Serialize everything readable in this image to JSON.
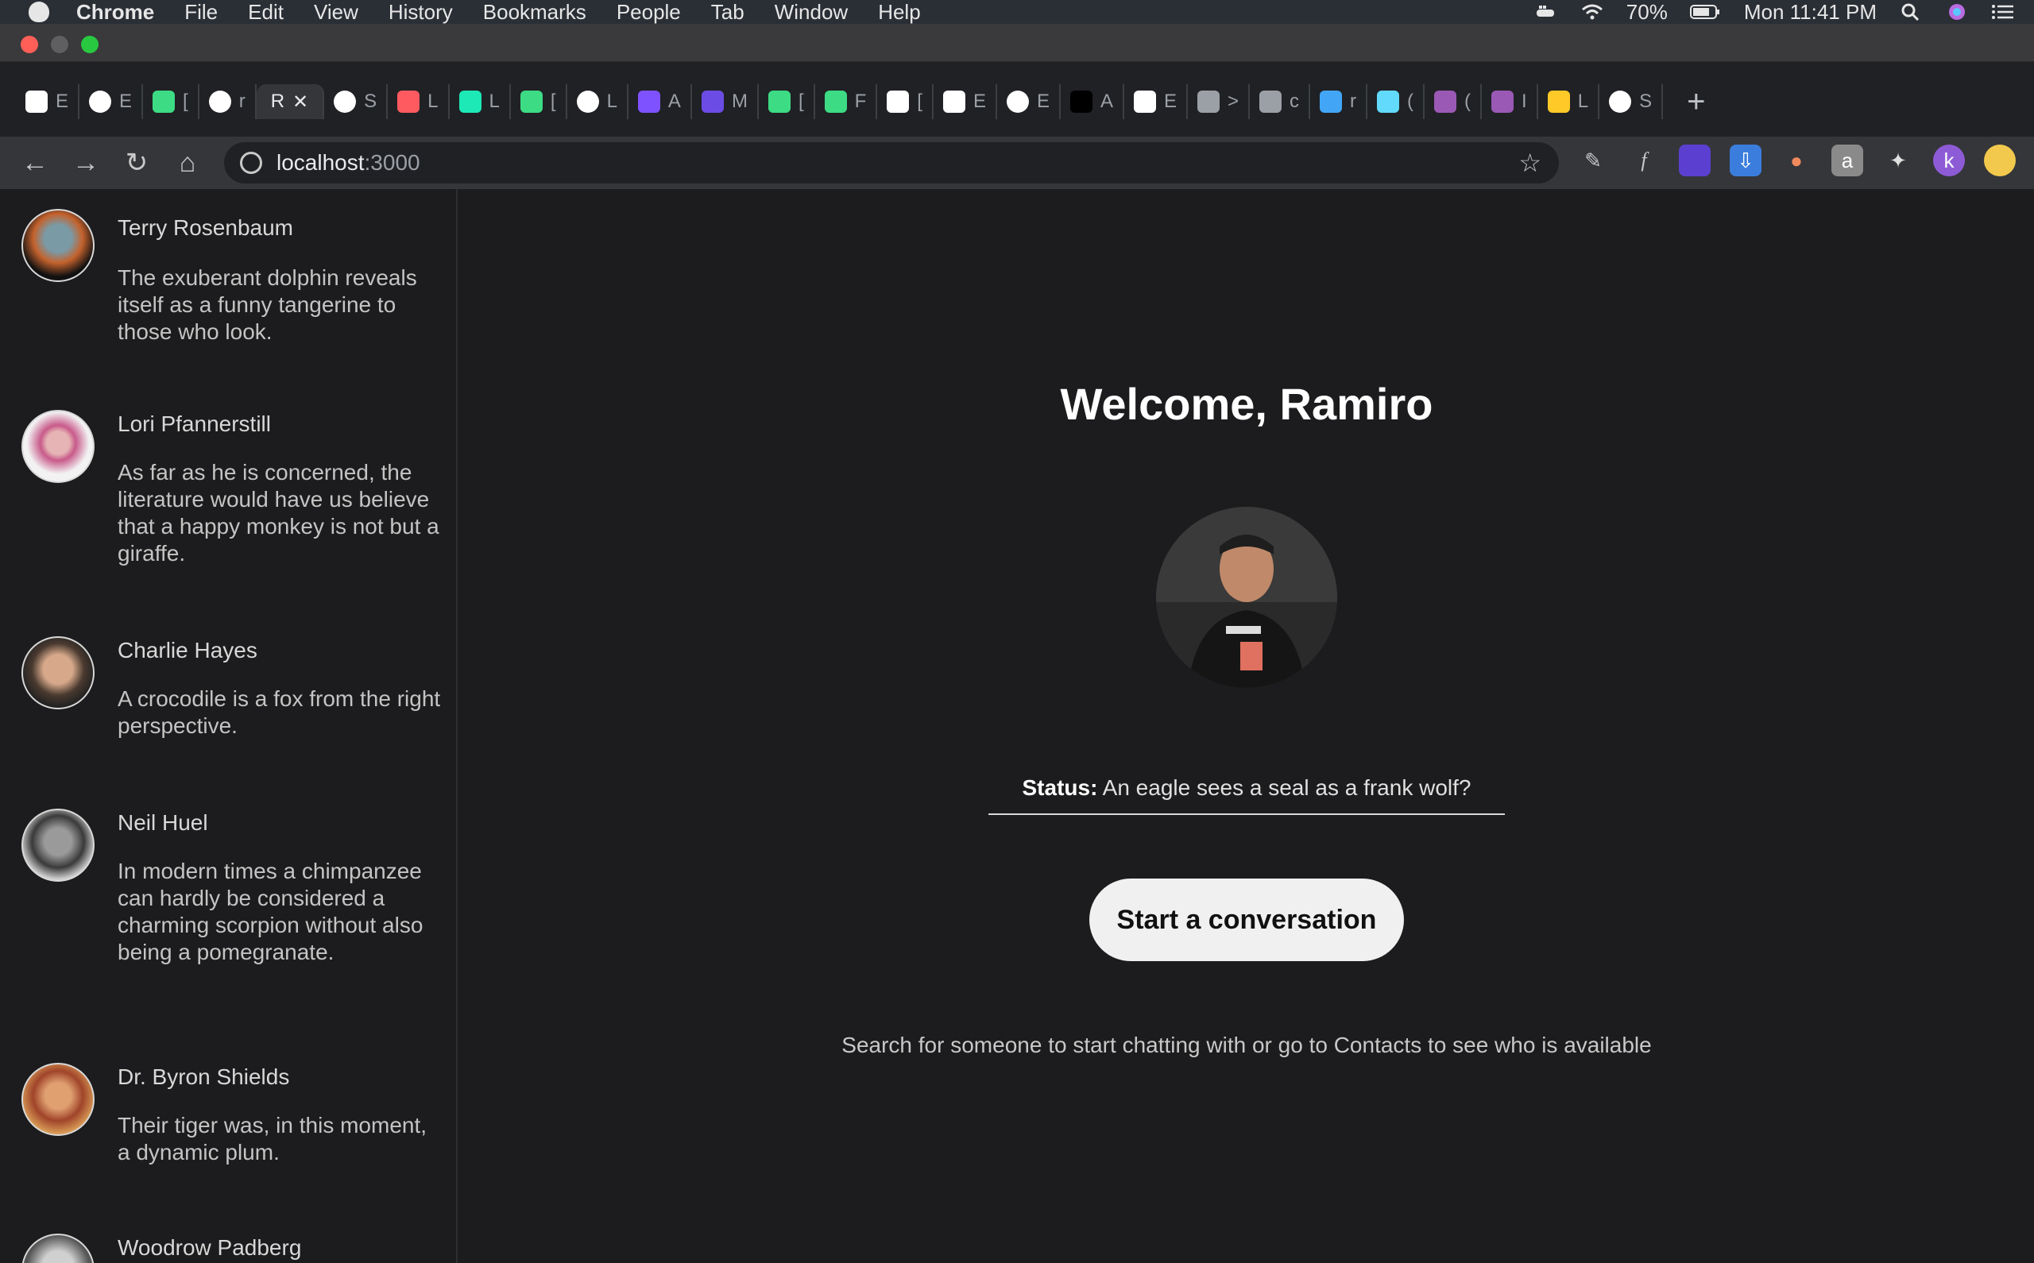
{
  "menubar": {
    "app": "Chrome",
    "items": [
      "File",
      "Edit",
      "View",
      "History",
      "Bookmarks",
      "People",
      "Tab",
      "Window",
      "Help"
    ],
    "battery": "70%",
    "clock": "Mon 11:41 PM"
  },
  "tabs": [
    {
      "label": "E",
      "icon": "gmail-icon",
      "color": "#ffffff"
    },
    {
      "label": "E",
      "icon": "compass-icon",
      "color": "#ffffff"
    },
    {
      "label": "[",
      "icon": "android-icon",
      "color": "#3ddc84"
    },
    {
      "label": "r",
      "icon": "github-icon",
      "color": "#ffffff"
    },
    {
      "label": "R",
      "icon": "",
      "color": "",
      "active": true
    },
    {
      "label": "S",
      "icon": "globe-icon",
      "color": "#ffffff"
    },
    {
      "label": "L",
      "icon": "airbnb-icon",
      "color": "#ff5a5f"
    },
    {
      "label": "L",
      "icon": "pen-icon",
      "color": "#1de9b6"
    },
    {
      "label": "[",
      "icon": "android-icon",
      "color": "#3ddc84"
    },
    {
      "label": "L",
      "icon": "compass-icon",
      "color": "#ffffff"
    },
    {
      "label": "A",
      "icon": "kotlin-icon",
      "color": "#7f52ff"
    },
    {
      "label": "M",
      "icon": "upwork-icon",
      "color": "#6b4de6"
    },
    {
      "label": "[",
      "icon": "android-icon",
      "color": "#3ddc84"
    },
    {
      "label": "F",
      "icon": "android-icon",
      "color": "#3ddc84"
    },
    {
      "label": "[",
      "icon": "medium-icon",
      "color": "#ffffff"
    },
    {
      "label": "E",
      "icon": "medium-icon",
      "color": "#ffffff"
    },
    {
      "label": "E",
      "icon": "meetup-icon",
      "color": "#ffffff"
    },
    {
      "label": "A",
      "icon": "dev-icon",
      "color": "#000000"
    },
    {
      "label": "E",
      "icon": "gmail-icon",
      "color": "#ffffff"
    },
    {
      "label": ">",
      "icon": "apple-icon",
      "color": "#9aa0a6"
    },
    {
      "label": "c",
      "icon": "apple-icon",
      "color": "#9aa0a6"
    },
    {
      "label": "r",
      "icon": "flutter-icon",
      "color": "#42a5f5"
    },
    {
      "label": "(",
      "icon": "react-icon",
      "color": "#61dafb"
    },
    {
      "label": "(",
      "icon": "graphql-icon",
      "color": "#9b59b6"
    },
    {
      "label": "I",
      "icon": "graphql-icon",
      "color": "#9b59b6"
    },
    {
      "label": "L",
      "icon": "firebase-icon",
      "color": "#ffca28"
    },
    {
      "label": "S",
      "icon": "github-icon",
      "color": "#ffffff"
    }
  ],
  "address": {
    "host": "localhost",
    "port": ":3000"
  },
  "contacts": [
    {
      "name": "Terry Rosenbaum",
      "status": "The exuberant dolphin reveals itself as a funny tangerine to those who look.",
      "avatar_color": "#8a5a3a"
    },
    {
      "name": "Lori Pfannerstill",
      "status": "As far as he is concerned, the literature would have us believe that a happy monkey is not but a giraffe.",
      "avatar_color": "#b56b7a"
    },
    {
      "name": "Charlie Hayes",
      "status": "A crocodile is a fox from the right perspective.",
      "avatar_color": "#a07a60"
    },
    {
      "name": "Neil Huel",
      "status": "In modern times a chimpanzee can hardly be considered a charming scorpion without also being a pomegranate.",
      "avatar_color": "#5a5a5a"
    },
    {
      "name": "Dr. Byron Shields",
      "status": "Their tiger was, in this moment, a dynamic plum.",
      "avatar_color": "#b05a3a"
    },
    {
      "name": "Woodrow Padberg",
      "status": "",
      "avatar_color": "#7a7a7a"
    }
  ],
  "main": {
    "welcome": "Welcome, Ramiro",
    "status_label": "Status:",
    "status_text": "An eagle sees a seal as a frank wolf?",
    "cta": "Start a conversation",
    "hint": "Search for someone to start chatting with or go to Contacts to see who is available"
  }
}
